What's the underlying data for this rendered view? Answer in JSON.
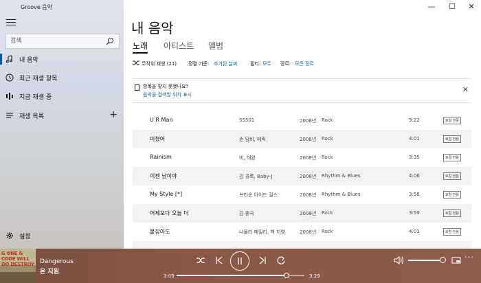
{
  "window": {
    "app_title": "Groove 음악",
    "minimize": "—",
    "maximize": "☐",
    "close": "✕"
  },
  "sidebar": {
    "search_placeholder": "검색",
    "items": [
      {
        "label": "내 음악",
        "icon": "music-note-icon",
        "selected": true
      },
      {
        "label": "최근 재생 항목",
        "icon": "clock-icon"
      },
      {
        "label": "지금 재생 중",
        "icon": "now-playing-icon"
      },
      {
        "label": "재생 목록",
        "icon": "playlist-icon",
        "add": "+"
      }
    ],
    "settings_label": "설정"
  },
  "main": {
    "title": "내 음악",
    "tabs": [
      {
        "label": "노래",
        "active": true
      },
      {
        "label": "아티스트"
      },
      {
        "label": "앨범"
      }
    ],
    "toolbar": {
      "shuffle_label": "무작위 재생 (21)",
      "sort_label": "정렬 기준:",
      "sort_value": "추가된 날짜",
      "filter_label": "필터:",
      "filter_value": "모두",
      "genre_label": "장르:",
      "genre_value": "모든 장르"
    },
    "notice": {
      "text": "항목을 찾지 못했나요?",
      "link": "음악을 검색할 위치 표시"
    },
    "songs": [
      {
        "title": "U R Man",
        "artist": "SS501",
        "year": "2008년",
        "genre": "Rock",
        "duration": "3:22",
        "badge": "로컬 전용"
      },
      {
        "title": "미쳤어",
        "artist": "손 담비, 에릭",
        "year": "2008년",
        "genre": "Rock",
        "duration": "4:01",
        "badge": "로컬 전용"
      },
      {
        "title": "Rainism",
        "artist": "비, 태완",
        "year": "2008년",
        "genre": "Rock",
        "duration": "3:35",
        "badge": "로컬 전용"
      },
      {
        "title": "이젠 남이야",
        "artist": "김 경록, Baby-J",
        "year": "2008년",
        "genre": "Rhythm & Blues",
        "duration": "4:06",
        "badge": "로컬 전용"
      },
      {
        "title": "My Style [*]",
        "artist": "브라운 아이드 걸스",
        "year": "2008년",
        "genre": "Rhythm & Blues",
        "duration": "3:58",
        "badge": "로컬 전용"
      },
      {
        "title": "어제보다 오늘 더",
        "artist": "김 종국",
        "year": "2008년",
        "genre": "Rock",
        "duration": "3:59",
        "badge": "로컬 전용"
      },
      {
        "title": "붙잡아도",
        "artist": "나몰라 패밀리, 백 지영",
        "year": "2008년",
        "genre": "Rock",
        "duration": "4:01",
        "badge": "로컬 전용"
      }
    ]
  },
  "player": {
    "album_text": "G ONE G CODE WILL DO DESTROY",
    "track_title": "Dangerous",
    "track_artist": "은 지원",
    "elapsed": "3:05",
    "remaining": "3:29",
    "progress_fraction": 0.86,
    "volume_fraction": 0.92,
    "colors": {
      "bar": "#8a5747",
      "accent": "#0063b1"
    }
  }
}
